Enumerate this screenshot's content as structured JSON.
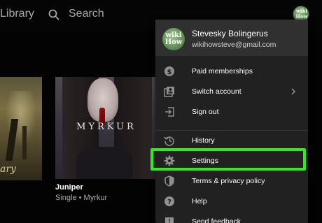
{
  "topbar": {
    "library_label": "Library",
    "search_label": "Search",
    "avatar_logo_line1": "wiki",
    "avatar_logo_line2": "How"
  },
  "albums": {
    "left_title_fragment": "ary",
    "main": {
      "art_text": "MYRKUR",
      "name": "Juniper",
      "meta": "Single • Myrkur"
    }
  },
  "account_menu": {
    "user_name": "Stevesky Bolingerus",
    "user_email": "wikihowsteve@gmail.com",
    "avatar_logo_line1": "wiki",
    "avatar_logo_line2": "How",
    "items": [
      {
        "label": "Paid memberships",
        "icon": "dollar-circle-icon"
      },
      {
        "label": "Switch account",
        "icon": "switch-account-icon",
        "has_submenu": true
      },
      {
        "label": "Sign out",
        "icon": "sign-out-icon"
      },
      {
        "label": "History",
        "icon": "history-icon"
      },
      {
        "label": "Settings",
        "icon": "gear-icon",
        "highlighted": true
      },
      {
        "label": "Terms & privacy policy",
        "icon": "shield-icon"
      },
      {
        "label": "Help",
        "icon": "help-icon"
      },
      {
        "label": "Send feedback",
        "icon": "feedback-icon"
      }
    ]
  },
  "colors": {
    "background": "#030303",
    "menu_background": "#212121",
    "menu_header": "#303030",
    "highlight_box": "#33ea1f"
  }
}
